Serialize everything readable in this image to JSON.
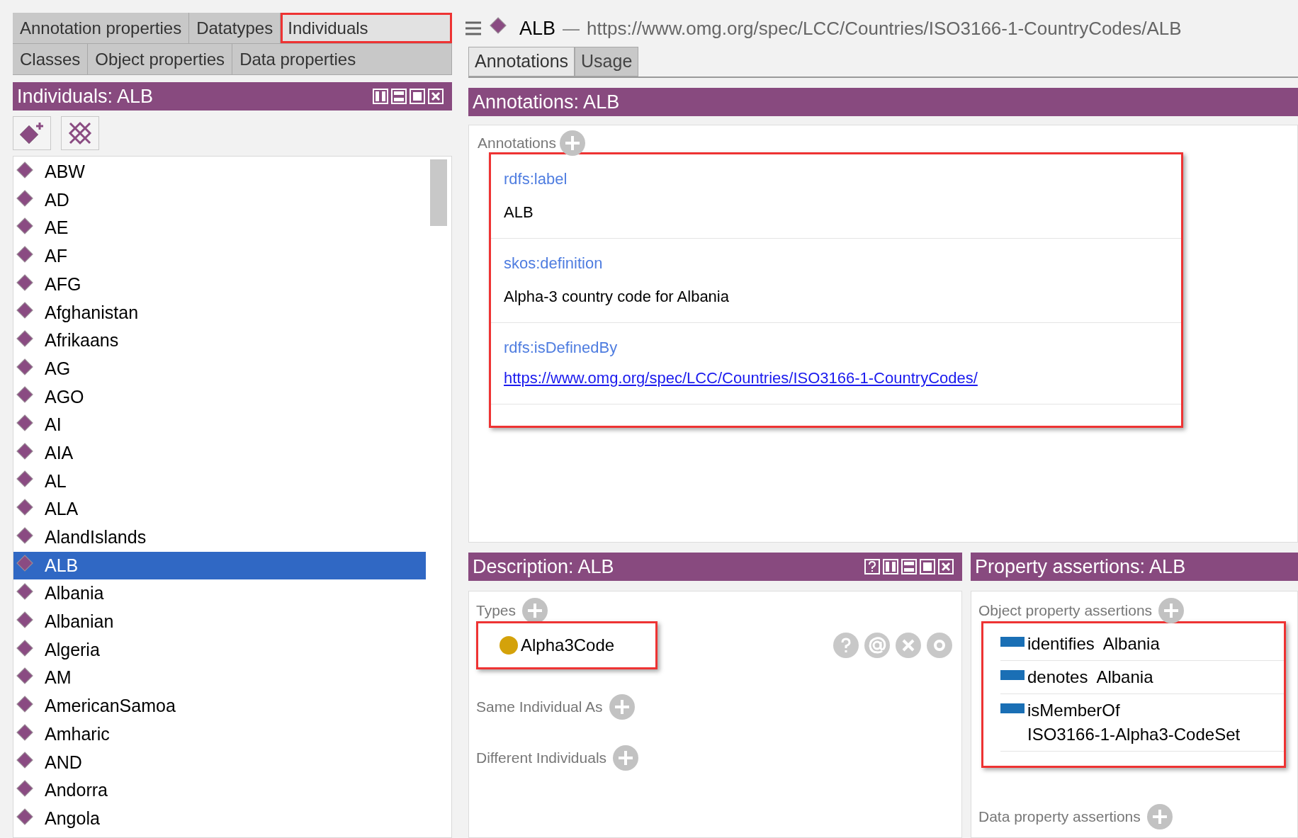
{
  "entity_tab_rows": [
    {
      "tabs": [
        {
          "label": "Annotation properties",
          "selected": false,
          "highlighted": false
        },
        {
          "label": "Datatypes",
          "selected": false,
          "highlighted": false
        },
        {
          "label": "Individuals",
          "selected": true,
          "highlighted": true
        }
      ]
    },
    {
      "tabs": [
        {
          "label": "Classes",
          "selected": false,
          "highlighted": false
        },
        {
          "label": "Object properties",
          "selected": false,
          "highlighted": false
        },
        {
          "label": "Data properties",
          "selected": false,
          "highlighted": false
        }
      ]
    }
  ],
  "individuals_view": {
    "title": "Individuals: ALB",
    "items": [
      {
        "label": "ABW",
        "selected": false
      },
      {
        "label": "AD",
        "selected": false
      },
      {
        "label": "AE",
        "selected": false
      },
      {
        "label": "AF",
        "selected": false
      },
      {
        "label": "AFG",
        "selected": false
      },
      {
        "label": "Afghanistan",
        "selected": false
      },
      {
        "label": "Afrikaans",
        "selected": false
      },
      {
        "label": "AG",
        "selected": false
      },
      {
        "label": "AGO",
        "selected": false
      },
      {
        "label": "AI",
        "selected": false
      },
      {
        "label": "AIA",
        "selected": false
      },
      {
        "label": "AL",
        "selected": false
      },
      {
        "label": "ALA",
        "selected": false
      },
      {
        "label": "AlandIslands",
        "selected": false
      },
      {
        "label": "ALB",
        "selected": true
      },
      {
        "label": "Albania",
        "selected": false
      },
      {
        "label": "Albanian",
        "selected": false
      },
      {
        "label": "Algeria",
        "selected": false
      },
      {
        "label": "AM",
        "selected": false
      },
      {
        "label": "AmericanSamoa",
        "selected": false
      },
      {
        "label": "Amharic",
        "selected": false
      },
      {
        "label": "AND",
        "selected": false
      },
      {
        "label": "Andorra",
        "selected": false
      },
      {
        "label": "Angola",
        "selected": false
      }
    ]
  },
  "entity": {
    "name": "ALB",
    "separator": "—",
    "iri": "https://www.omg.org/spec/LCC/Countries/ISO3166-1-CountryCodes/ALB"
  },
  "detail_tabs": [
    {
      "label": "Annotations",
      "selected": true
    },
    {
      "label": "Usage",
      "selected": false
    }
  ],
  "annotations_view": {
    "title": "Annotations: ALB",
    "section": "Annotations",
    "highlighted": true,
    "entries": [
      {
        "property": "rdfs:label",
        "value": "ALB",
        "kind": "text"
      },
      {
        "property": "skos:definition",
        "value": "Alpha-3 country code for Albania",
        "kind": "text"
      },
      {
        "property": "rdfs:isDefinedBy",
        "value": "https://www.omg.org/spec/LCC/Countries/ISO3166-1-CountryCodes/",
        "kind": "link"
      }
    ]
  },
  "description_view": {
    "title": "Description: ALB",
    "sections": [
      {
        "label": "Types",
        "highlighted": true,
        "items": [
          {
            "label": "Alpha3Code",
            "color": "#d4a20a"
          }
        ]
      },
      {
        "label": "Same Individual As"
      },
      {
        "label": "Different Individuals"
      }
    ]
  },
  "property_assertions_view": {
    "title": "Property assertions: ALB",
    "sections": [
      {
        "label": "Object property assertions",
        "highlighted": true,
        "items": [
          {
            "property": "identifies",
            "value": "Albania"
          },
          {
            "property": "denotes",
            "value": "Albania"
          },
          {
            "property": "isMemberOf",
            "value": "ISO3166-1-Alpha3-CodeSet"
          }
        ]
      },
      {
        "label": "Data property assertions"
      }
    ]
  }
}
